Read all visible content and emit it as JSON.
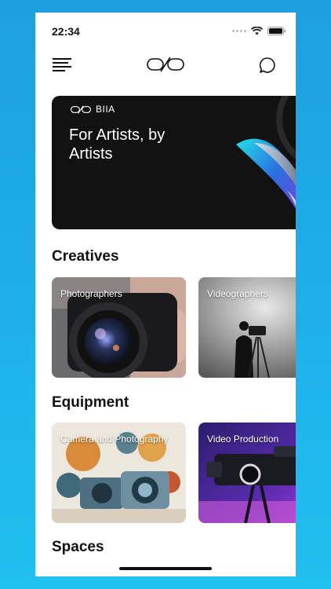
{
  "status": {
    "time": "22:34"
  },
  "nav": {
    "menu_icon": "menu-icon",
    "logo_icon": "link-logo-icon",
    "chat_icon": "chat-bubble-icon"
  },
  "hero": {
    "brand": "BIIA",
    "title": "For Artists, by Artists"
  },
  "sections": {
    "creatives": {
      "title": "Creatives",
      "cards": [
        {
          "label": "Photographers"
        },
        {
          "label": "Videographers"
        }
      ]
    },
    "equipment": {
      "title": "Equipment",
      "cards": [
        {
          "label": "Camera and Photography"
        },
        {
          "label": "Video Production"
        }
      ]
    },
    "spaces": {
      "title": "Spaces"
    }
  },
  "colors": {
    "background": "#1fb0ea",
    "hero_bg": "#121212",
    "text": "#111111"
  }
}
